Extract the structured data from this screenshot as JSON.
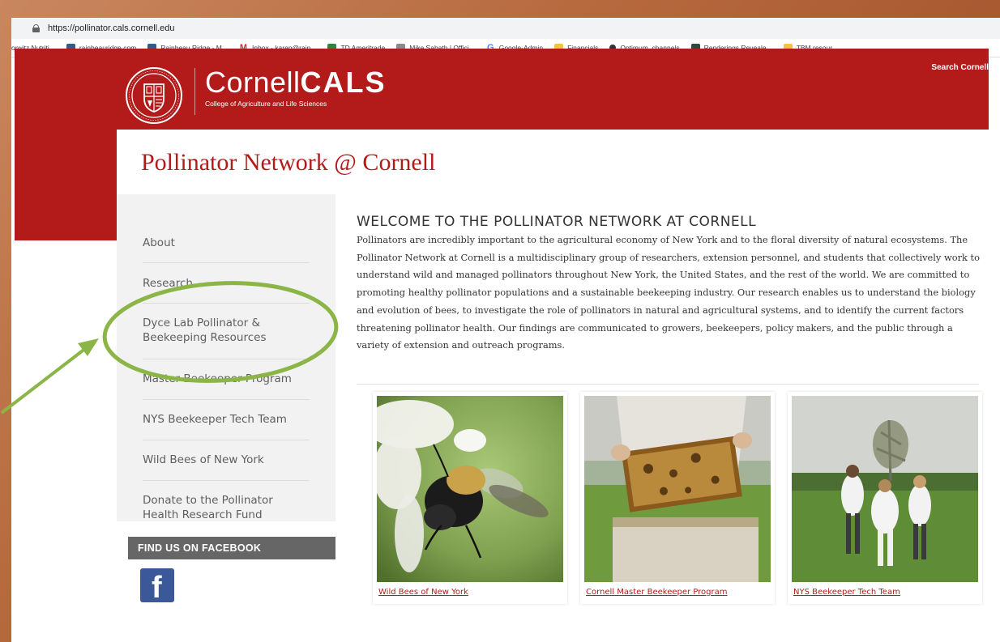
{
  "browser": {
    "url": "https://pollinator.cals.cornell.edu",
    "bookmarks": [
      {
        "label": "orwitz Nutriti...",
        "icon": "blank",
        "color": ""
      },
      {
        "label": "rainbeauridge.com",
        "icon": "site-icon",
        "color": "#2e5d8a"
      },
      {
        "label": "Rainbeau Ridge - M...",
        "icon": "site-icon",
        "color": "#2e5d8a"
      },
      {
        "label": "Inbox - karen@rain...",
        "icon": "gmail-icon",
        "color": "#d93025"
      },
      {
        "label": "TD Ameritrade",
        "icon": "td-icon",
        "color": "#2e8540"
      },
      {
        "label": "Mike Sabath | Offici...",
        "icon": "site-icon",
        "color": "#8a8a8a"
      },
      {
        "label": "Google-Admin",
        "icon": "google-icon",
        "color": "#4285f4"
      },
      {
        "label": "Financials",
        "icon": "folder-icon",
        "color": "#f5c344"
      },
      {
        "label": "Optimum_channels",
        "icon": "optimum-icon",
        "color": "#333333"
      },
      {
        "label": "Renderings Reveale...",
        "icon": "site-icon",
        "color": "#2a4d3a"
      },
      {
        "label": "TBM resour",
        "icon": "folder-icon",
        "color": "#f5c344"
      }
    ]
  },
  "header": {
    "brand_light": "Cornell",
    "brand_bold": "CALS",
    "brand_sub": "College of Agriculture and Life Sciences",
    "search_link": "Search Cornell",
    "brand_color": "#b31b1b"
  },
  "site_title": "Pollinator Network @ Cornell",
  "sidebar": {
    "items": [
      {
        "label": "About"
      },
      {
        "label": "Research"
      },
      {
        "label": "Dyce Lab Pollinator & Beekeeping Resources"
      },
      {
        "label": "Master Beekeeper Program"
      },
      {
        "label": "NYS Beekeeper Tech Team"
      },
      {
        "label": "Wild Bees of New York"
      },
      {
        "label": "Donate to the Pollinator Health Research Fund"
      }
    ],
    "facebook_heading": "FIND US ON FACEBOOK",
    "facebook_glyph": "f"
  },
  "main": {
    "heading": "WELCOME TO THE POLLINATOR NETWORK AT CORNELL",
    "intro": "Pollinators are incredibly important to the agricultural economy of New York and to the floral diversity of natural ecosystems. The Pollinator Network at Cornell is a multidisciplinary group of researchers, extension personnel, and students that collectively work to understand wild and managed pollinators throughout New York, the United States, and the rest of the world. We are committed to promoting healthy pollinator populations and a sustainable beekeeping industry. Our research enables us to understand the biology and evolution of bees, to investigate the role of pollinators in natural and agricultural systems, and to identify the current factors threatening pollinator health. Our findings are communicated to growers, beekeepers, policy makers, and the public through a variety of extension and outreach programs.",
    "cards": [
      {
        "caption": "Wild Bees of New York"
      },
      {
        "caption": "Cornell Master Beekeeper Program"
      },
      {
        "caption": "NYS Beekeeper Tech Team"
      }
    ]
  },
  "annotation": {
    "color": "#8cb548"
  }
}
